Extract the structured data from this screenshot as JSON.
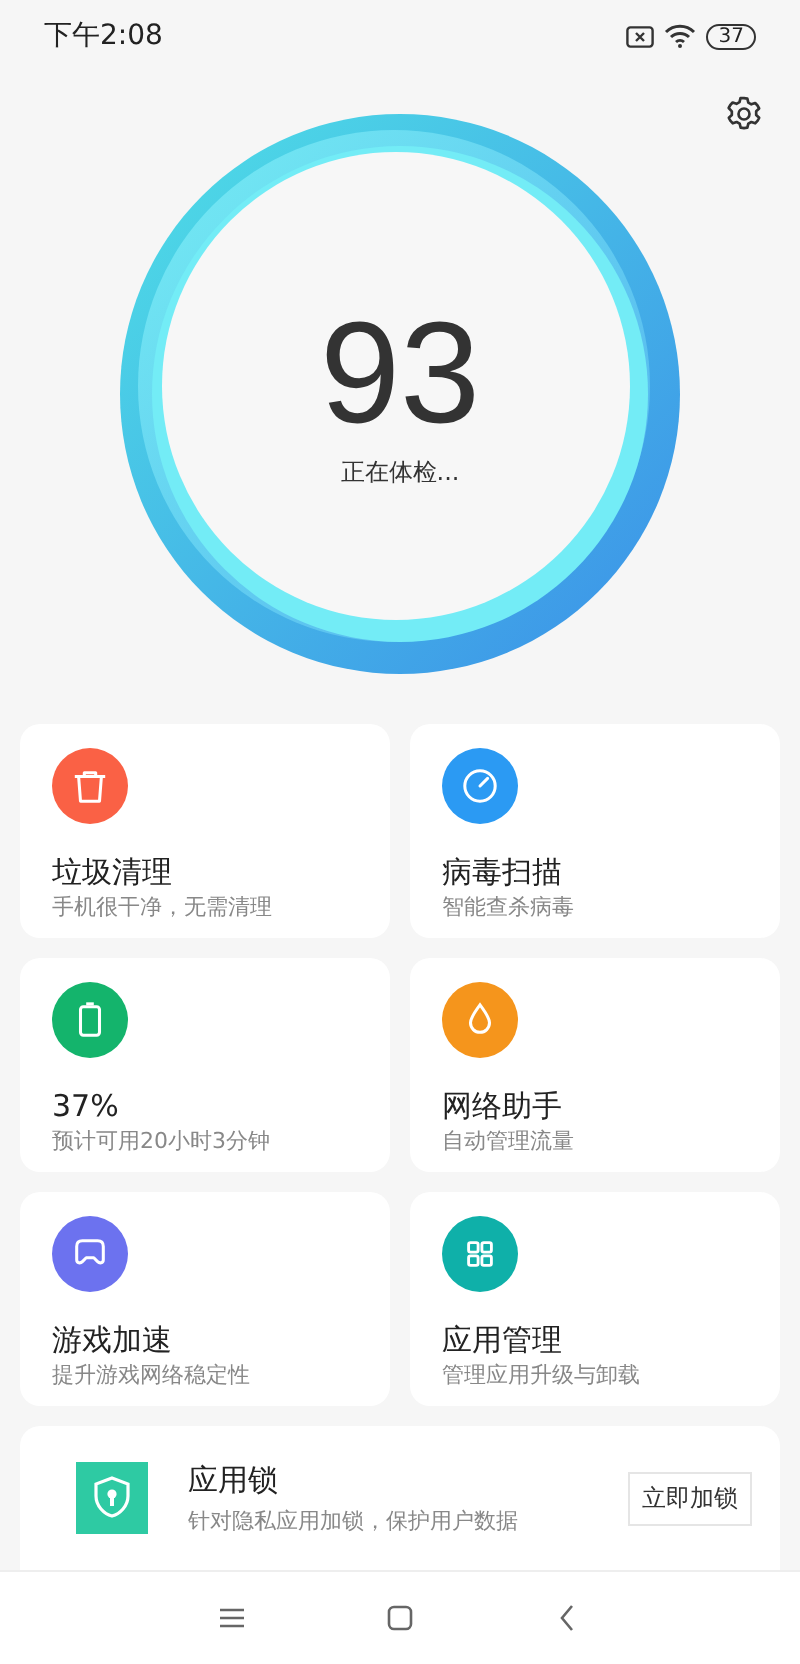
{
  "status_bar": {
    "time": "下午2:08",
    "battery": "37"
  },
  "score": {
    "value": "93",
    "caption": "正在体检..."
  },
  "tiles": [
    {
      "kind": "trash",
      "color": "#fa6145",
      "title": "垃圾清理",
      "subtitle": "手机很干净，无需清理"
    },
    {
      "kind": "gauge",
      "color": "#2b9af3",
      "title": "病毒扫描",
      "subtitle": "智能查杀病毒"
    },
    {
      "kind": "battery",
      "color": "#14b46c",
      "title": "37%",
      "subtitle": "预计可用20小时3分钟"
    },
    {
      "kind": "drop",
      "color": "#f5951c",
      "title": "网络助手",
      "subtitle": "自动管理流量"
    },
    {
      "kind": "gamepad",
      "color": "#6c72ef",
      "title": "游戏加速",
      "subtitle": "提升游戏网络稳定性"
    },
    {
      "kind": "grid",
      "color": "#0fb0a9",
      "title": "应用管理",
      "subtitle": "管理应用升级与卸载"
    }
  ],
  "app_lock": {
    "title": "应用锁",
    "subtitle": "针对隐私应用加锁，保护用户数据",
    "button": "立即加锁"
  },
  "nav_bar": {
    "buttons": [
      {
        "kind": "menu"
      },
      {
        "kind": "home"
      },
      {
        "kind": "back"
      }
    ]
  }
}
